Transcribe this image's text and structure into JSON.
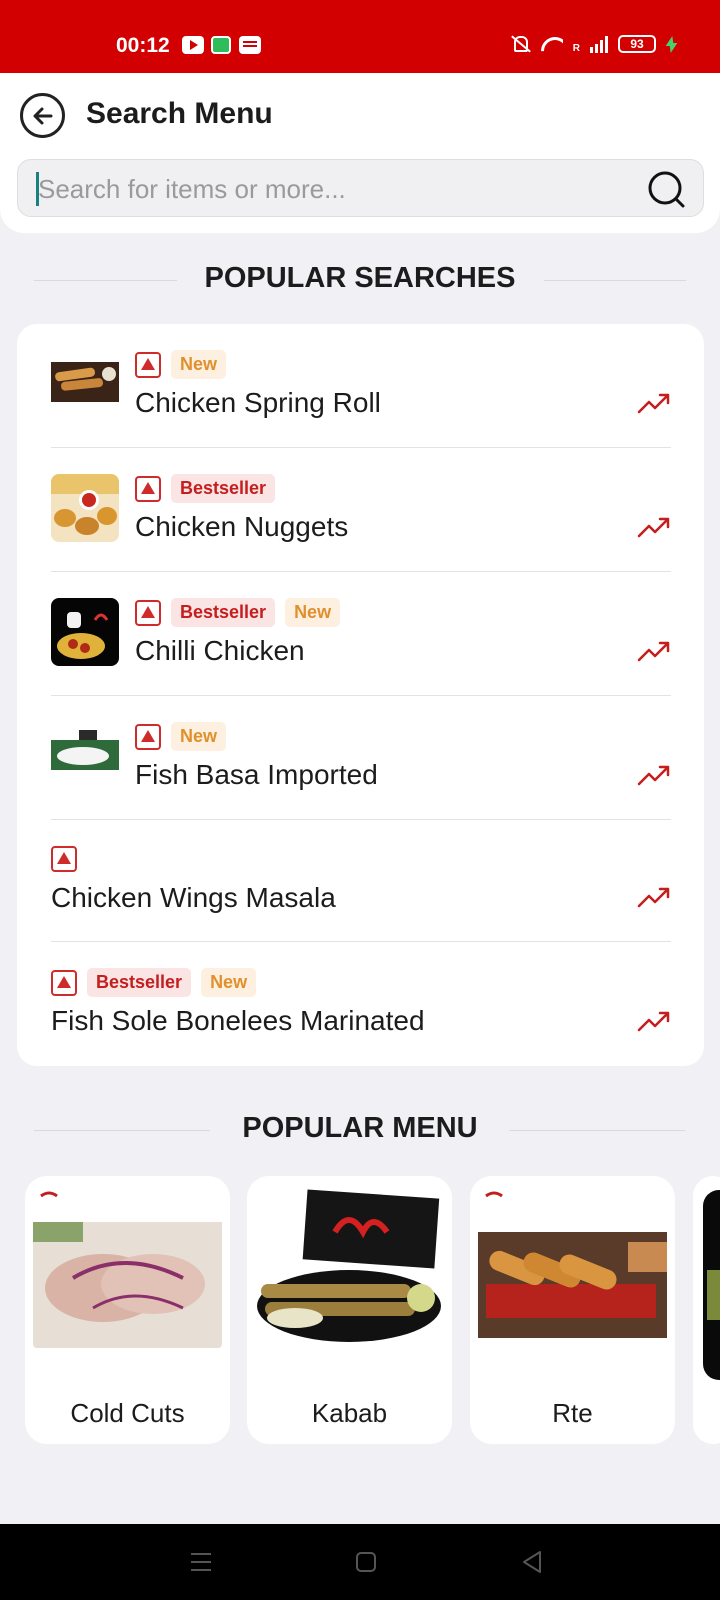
{
  "status_bar": {
    "time": "00:12",
    "signal_tag": "R",
    "battery": "93"
  },
  "header": {
    "title": "Search Menu",
    "search": {
      "placeholder": "Search for items or more...",
      "value": ""
    }
  },
  "popular_searches": {
    "heading": "POPULAR SEARCHES",
    "items": [
      {
        "name": "Chicken Spring Roll",
        "badges": [
          "New"
        ]
      },
      {
        "name": "Chicken Nuggets",
        "badges": [
          "Bestseller"
        ]
      },
      {
        "name": "Chilli Chicken",
        "badges": [
          "Bestseller",
          "New"
        ]
      },
      {
        "name": "Fish Basa Imported",
        "badges": [
          "New"
        ]
      },
      {
        "name": "Chicken Wings Masala",
        "badges": []
      },
      {
        "name": "Fish Sole Bonelees Marinated",
        "badges": [
          "Bestseller",
          "New"
        ]
      }
    ]
  },
  "popular_menu": {
    "heading": "POPULAR MENU",
    "items": [
      {
        "label": "Cold Cuts"
      },
      {
        "label": "Kabab"
      },
      {
        "label": "Rte"
      }
    ]
  },
  "colors": {
    "brand_red": "#d20000",
    "bestseller": "#c41e1e",
    "new": "#e0902d"
  },
  "icons": [
    "back-arrow-icon",
    "search-icon",
    "trending-up-icon",
    "non-veg-icon",
    "nav-menu-icon",
    "nav-home-icon",
    "nav-back-icon"
  ]
}
